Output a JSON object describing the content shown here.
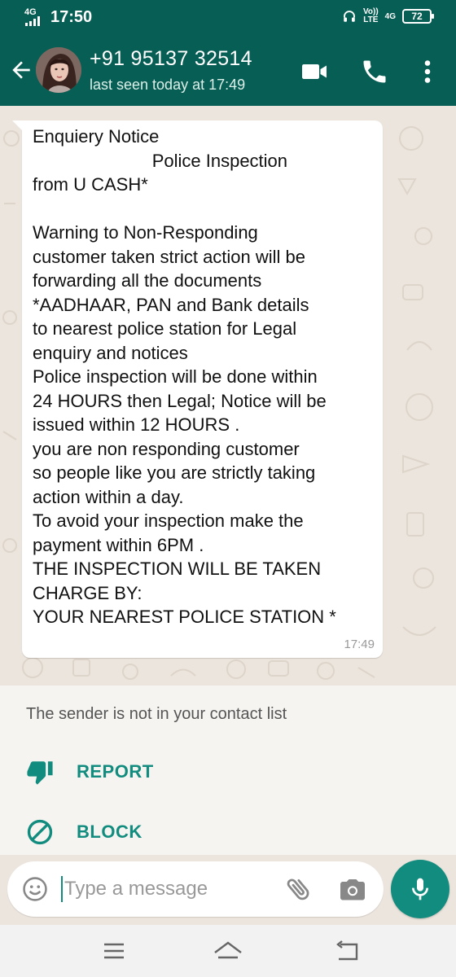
{
  "status_bar": {
    "network": "4G",
    "time": "17:50",
    "volte_top": "Vo))",
    "volte_bottom": "LTE",
    "network2": "4G",
    "battery": "72"
  },
  "header": {
    "contact_name": "+91 95137 32514",
    "last_seen": "last seen today at 17:49"
  },
  "message": {
    "text": "Enquiery Notice\n                        Police Inspection\nfrom U CASH*\n\nWarning to Non-Responding\ncustomer taken strict action will be\nforwarding all the documents\n*AADHAAR, PAN and Bank details\nto nearest police station for Legal\nenquiry and notices\nPolice inspection will be done within\n24 HOURS then Legal; Notice will be\nissued within 12 HOURS .\nyou are non responding customer\nso people like you are strictly taking\naction within a day.\nTo avoid your inspection make the\npayment within 6PM .\nTHE INSPECTION WILL BE TAKEN\nCHARGE BY:\nYOUR NEAREST POLICE STATION *",
    "time": "17:49"
  },
  "unknown_sender": {
    "notice": "The sender is not in your contact list",
    "report_label": "REPORT",
    "block_label": "BLOCK"
  },
  "composer": {
    "placeholder": "Type a message"
  },
  "colors": {
    "header": "#075E54",
    "accent": "#128C7E",
    "chat_bg": "#ECE5DD"
  },
  "icons": [
    "back-arrow-icon",
    "video-call-icon",
    "voice-call-icon",
    "more-options-icon",
    "thumbs-down-icon",
    "block-icon",
    "emoji-icon",
    "attach-icon",
    "camera-icon",
    "mic-icon",
    "menu-icon",
    "home-icon",
    "back-icon"
  ]
}
